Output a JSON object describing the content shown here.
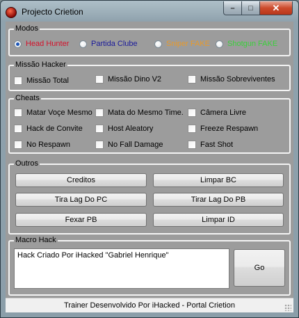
{
  "window": {
    "title": "Projecto Crietion",
    "minimize": "–",
    "maximize": "□",
    "close": "✕"
  },
  "modos": {
    "legend": "Modos",
    "options": [
      {
        "label": "Head Hunter",
        "color": "#d4102a",
        "selected": true
      },
      {
        "label": "Partida Clube",
        "color": "#1a1a9a",
        "selected": false
      },
      {
        "label": "Sniper FAKE",
        "color": "#e89a2a",
        "selected": false
      },
      {
        "label": "Shotgun FAKE",
        "color": "#3ad03a",
        "selected": false
      }
    ]
  },
  "missao": {
    "legend": "Missão Hacker",
    "options": [
      "Missão Total",
      "Missão Dino V2",
      "Missão Sobreviventes"
    ]
  },
  "cheats": {
    "legend": "Cheats",
    "options": [
      "Matar Voçe Mesmo",
      "Mata do Mesmo Time.",
      "Câmera Livre",
      "Hack de Convite",
      "Host Aleatory",
      "Freeze Respawn",
      "No Respawn",
      "No Fall Damage",
      "Fast Shot"
    ]
  },
  "outros": {
    "legend": "Outros",
    "buttons": [
      "Creditos",
      "Limpar BC",
      "Tira Lag Do PC",
      "Tirar Lag Do PB",
      "Fexar PB",
      "Limpar ID"
    ]
  },
  "macro": {
    "legend": "Macro Hack",
    "text": "Hack Criado Por iHacked \"Gabriel Henrique\"",
    "go_label": "Go"
  },
  "status": {
    "text": "Trainer Desenvolvido Por iHacked - Portal Crietion"
  }
}
